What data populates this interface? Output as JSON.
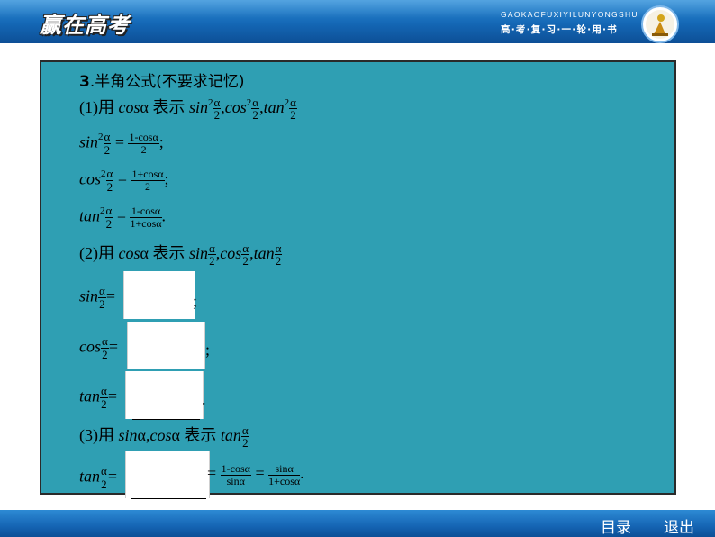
{
  "header": {
    "logo_text": "赢在高考",
    "pinyin": "GAOKAOFUXIYILUNYONGSHU",
    "subtitle": "高·考·复·习·一·轮·用·书"
  },
  "content": {
    "heading_num": "3",
    "heading_text": ".半角公式(不要求记忆)",
    "p1_prefix": "(1)用 ",
    "p1_cos": "cos",
    "p1_alpha": "α",
    "p1_mid": " 表示 ",
    "sin": "sin",
    "cos": "cos",
    "tan": "tan",
    "sq": "2",
    "half_num": "α",
    "half_den": "2",
    "comma": ",",
    "eq": "=",
    "semicolon": ";",
    "period": ".",
    "f1_num": "1-cosα",
    "f2_num": "1+cosα",
    "f3_num": "1-cosα",
    "f3_den": "1+cosα",
    "p2_prefix": "(2)用 ",
    "p3_prefix": "(3)用 ",
    "p3_sin": "sin",
    "p3_alpha1": "α,",
    "p3_cos": "cos",
    "p3_alpha2": "α",
    "p3_mid": " 表示 ",
    "g1_num": "1-cosα",
    "g1_den": "sinα",
    "g2_num": "sinα",
    "g2_den": "1+cosα"
  },
  "footer": {
    "menu_label": "目录",
    "exit_label": "退出"
  }
}
